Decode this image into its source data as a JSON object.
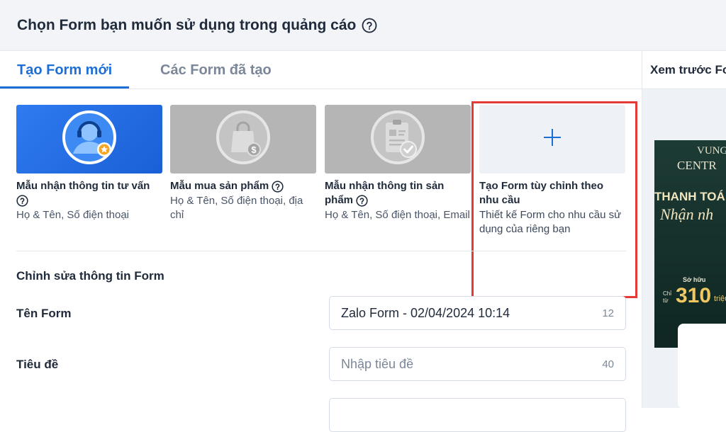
{
  "header": {
    "title": "Chọn Form bạn muốn sử dụng trong quảng cáo"
  },
  "tabs": [
    {
      "label": "Tạo Form mới",
      "active": true
    },
    {
      "label": "Các Form đã tạo",
      "active": false
    }
  ],
  "templates": [
    {
      "title": "Mẫu nhận thông tin tư vấn",
      "desc": "Họ & Tên, Số điện thoại",
      "icon": "consultant-headset-icon"
    },
    {
      "title": "Mẫu mua sản phẩm",
      "desc": "Họ & Tên, Số điện thoại, địa chỉ",
      "icon": "shopping-bag-icon"
    },
    {
      "title": "Mẫu nhận thông tin sản phẩm",
      "desc": "Họ & Tên, Số điện thoại, Email",
      "icon": "product-document-icon"
    },
    {
      "title": "Tạo Form tùy chỉnh theo nhu cầu",
      "desc": "Thiết kế Form cho nhu cầu sử dụng của riêng bạn",
      "icon": "plus-icon"
    }
  ],
  "edit": {
    "section_title": "Chỉnh sửa thông tin Form",
    "name_label": "Tên Form",
    "name_value": "Zalo Form - 02/04/2024 10:14",
    "name_count": "12",
    "title_label": "Tiêu đề",
    "title_placeholder": "Nhập tiêu đề",
    "title_count": "40"
  },
  "preview": {
    "heading": "Xem trước Fo",
    "banner_line1": "VUNG",
    "banner_line2": "CENTR",
    "banner_line3": "THANH TOÁ",
    "banner_line4": "Nhận nh",
    "banner_so_huu": "Sở hữu",
    "banner_chi_tu": "Chỉ từ",
    "banner_price": "310",
    "banner_unit": "triệu"
  },
  "colors": {
    "accent": "#1e6ed8",
    "highlight": "#e53935",
    "card_blue": "#2f7bf0",
    "card_grey": "#b5b5b5"
  }
}
